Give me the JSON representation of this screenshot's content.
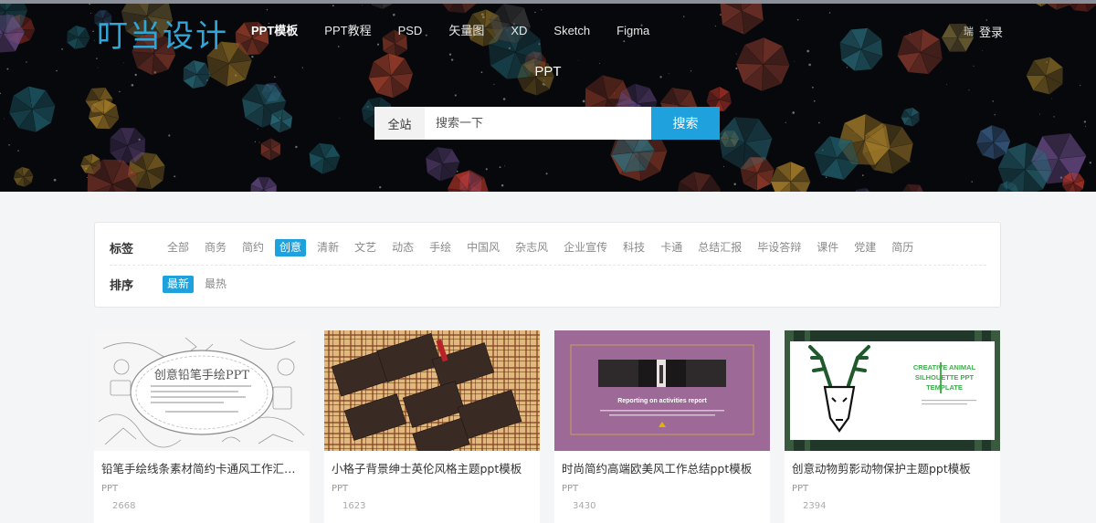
{
  "header": {
    "logo": "叮当设计",
    "nav": [
      {
        "label": "PPT模板",
        "active": true
      },
      {
        "label": "PPT教程",
        "active": false
      },
      {
        "label": "PSD",
        "active": false
      },
      {
        "label": "矢量图",
        "active": false
      },
      {
        "label": "XD",
        "active": false
      },
      {
        "label": "Sketch",
        "active": false
      },
      {
        "label": "Figma",
        "active": false
      }
    ],
    "login_avatar": "瑞",
    "login_label": "登录"
  },
  "hero": {
    "title": "PPT",
    "search": {
      "scope": "全站",
      "placeholder": "搜索一下",
      "button": "搜索"
    }
  },
  "filters": {
    "tag_label": "标签",
    "tags": [
      {
        "label": "全部",
        "active": false
      },
      {
        "label": "商务",
        "active": false
      },
      {
        "label": "简约",
        "active": false
      },
      {
        "label": "创意",
        "active": true
      },
      {
        "label": "清新",
        "active": false
      },
      {
        "label": "文艺",
        "active": false
      },
      {
        "label": "动态",
        "active": false
      },
      {
        "label": "手绘",
        "active": false
      },
      {
        "label": "中国风",
        "active": false
      },
      {
        "label": "杂志风",
        "active": false
      },
      {
        "label": "企业宣传",
        "active": false
      },
      {
        "label": "科技",
        "active": false
      },
      {
        "label": "卡通",
        "active": false
      },
      {
        "label": "总结汇报",
        "active": false
      },
      {
        "label": "毕设答辩",
        "active": false
      },
      {
        "label": "课件",
        "active": false
      },
      {
        "label": "党建",
        "active": false
      },
      {
        "label": "简历",
        "active": false
      }
    ],
    "sort_label": "排序",
    "sorts": [
      {
        "label": "最新",
        "active": true
      },
      {
        "label": "最热",
        "active": false
      }
    ]
  },
  "cards": [
    {
      "title": "铅笔手绘线条素材简约卡通风工作汇报ppt模板",
      "category": "PPT",
      "count": "2668",
      "thumb_text": "创意铅笔手绘PPT"
    },
    {
      "title": "小格子背景绅士英伦风格主题ppt模板",
      "category": "PPT",
      "count": "1623"
    },
    {
      "title": "时尚简约高端欧美风工作总结ppt模板",
      "category": "PPT",
      "count": "3430",
      "thumb_text": "Reporting on activities report"
    },
    {
      "title": "创意动物剪影动物保护主题ppt模板",
      "category": "PPT",
      "count": "2394",
      "thumb_text_1": "CREATIVE ANIMAL",
      "thumb_text_2": "SILHOUETTE PPT",
      "thumb_text_3": "TEMPLATE"
    }
  ],
  "colors": {
    "accent": "#1ea1dc",
    "logo": "#2fa6d8",
    "hero_bg": "#07080c"
  }
}
